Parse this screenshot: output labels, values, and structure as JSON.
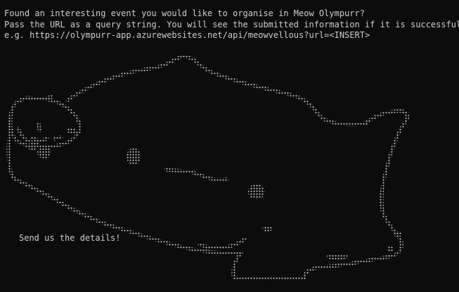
{
  "console": {
    "background": "#0c0c0c",
    "foreground": "#cccccc",
    "lines": [
      "Found an interesting event you would like to organise in Meow Olympurr?",
      "Pass the URL as a query string. You will see the submitted information if it is successful.",
      "e.g. https://olympurr-app.azurewebsites.net/api/meowvellous?url=<INSERT>"
    ],
    "cta": "Send us the details!"
  },
  "art": {
    "type": "braille-ascii-cat",
    "glyph": "braille-dots"
  }
}
